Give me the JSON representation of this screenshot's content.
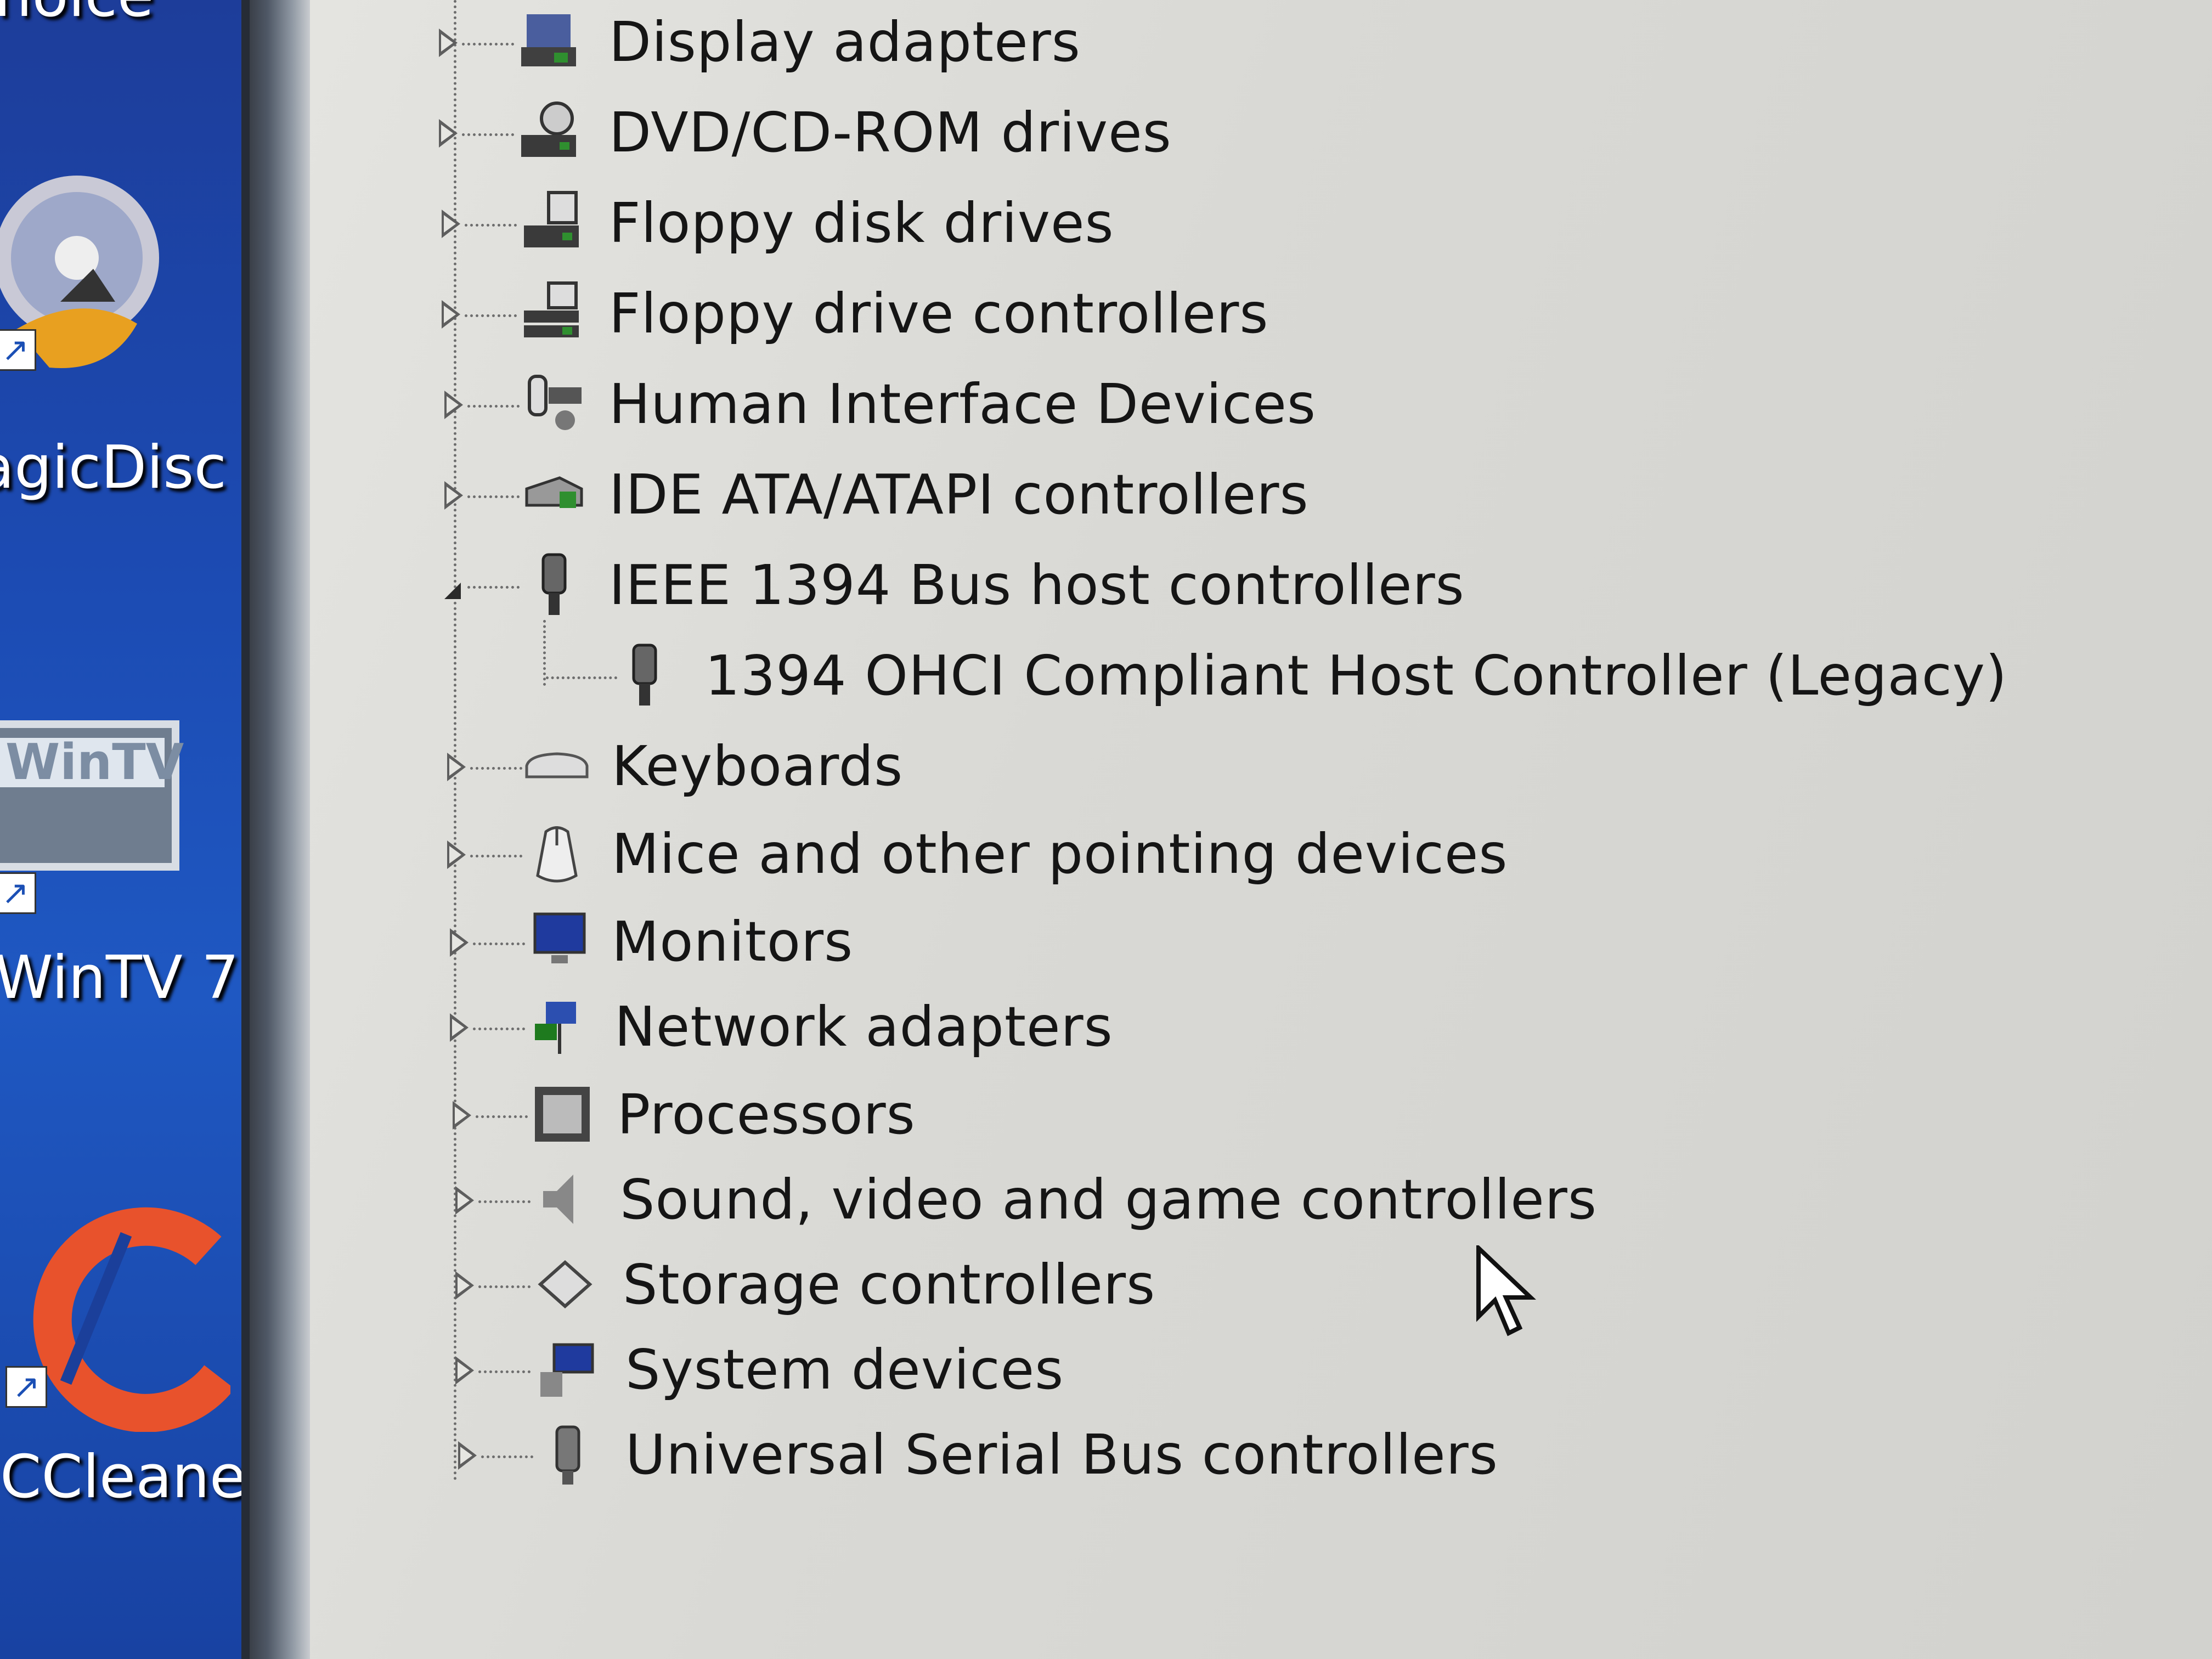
{
  "desktop": {
    "top_label_partial": "noice",
    "icons": [
      {
        "label": "agicDisc",
        "icon": "magicdisc-icon"
      },
      {
        "label": "WinTV 7",
        "icon": "wintv-icon",
        "logo_text": "WinTV"
      },
      {
        "label": "CCleaner",
        "icon": "ccleaner-icon"
      }
    ]
  },
  "device_manager": {
    "categories": [
      {
        "label": "Display adapters",
        "icon": "display-adapter-icon",
        "expanded": false
      },
      {
        "label": "DVD/CD-ROM drives",
        "icon": "dvd-drive-icon",
        "expanded": false
      },
      {
        "label": "Floppy disk drives",
        "icon": "floppy-disk-icon",
        "expanded": false
      },
      {
        "label": "Floppy drive controllers",
        "icon": "floppy-controller-icon",
        "expanded": false
      },
      {
        "label": "Human Interface Devices",
        "icon": "hid-icon",
        "expanded": false
      },
      {
        "label": "IDE ATA/ATAPI controllers",
        "icon": "ide-controller-icon",
        "expanded": false
      },
      {
        "label": "IEEE 1394 Bus host controllers",
        "icon": "firewire-icon",
        "expanded": true,
        "children": [
          {
            "label": "1394 OHCI Compliant Host Controller (Legacy)",
            "icon": "firewire-icon"
          }
        ]
      },
      {
        "label": "Keyboards",
        "icon": "keyboard-icon",
        "expanded": false
      },
      {
        "label": "Mice and other pointing devices",
        "icon": "mouse-icon",
        "expanded": false
      },
      {
        "label": "Monitors",
        "icon": "monitor-icon",
        "expanded": false
      },
      {
        "label": "Network adapters",
        "icon": "network-adapter-icon",
        "expanded": false
      },
      {
        "label": "Processors",
        "icon": "processor-icon",
        "expanded": false
      },
      {
        "label": "Sound, video and game controllers",
        "icon": "speaker-icon",
        "expanded": false
      },
      {
        "label": "Storage controllers",
        "icon": "storage-controller-icon",
        "expanded": false
      },
      {
        "label": "System devices",
        "icon": "system-devices-icon",
        "expanded": false
      },
      {
        "label": "Universal Serial Bus controllers",
        "icon": "usb-icon",
        "expanded": false
      }
    ]
  },
  "colors": {
    "desktop_blue": "#1c4bb3",
    "tree_background": "#dcdcd8",
    "text": "#151515"
  }
}
